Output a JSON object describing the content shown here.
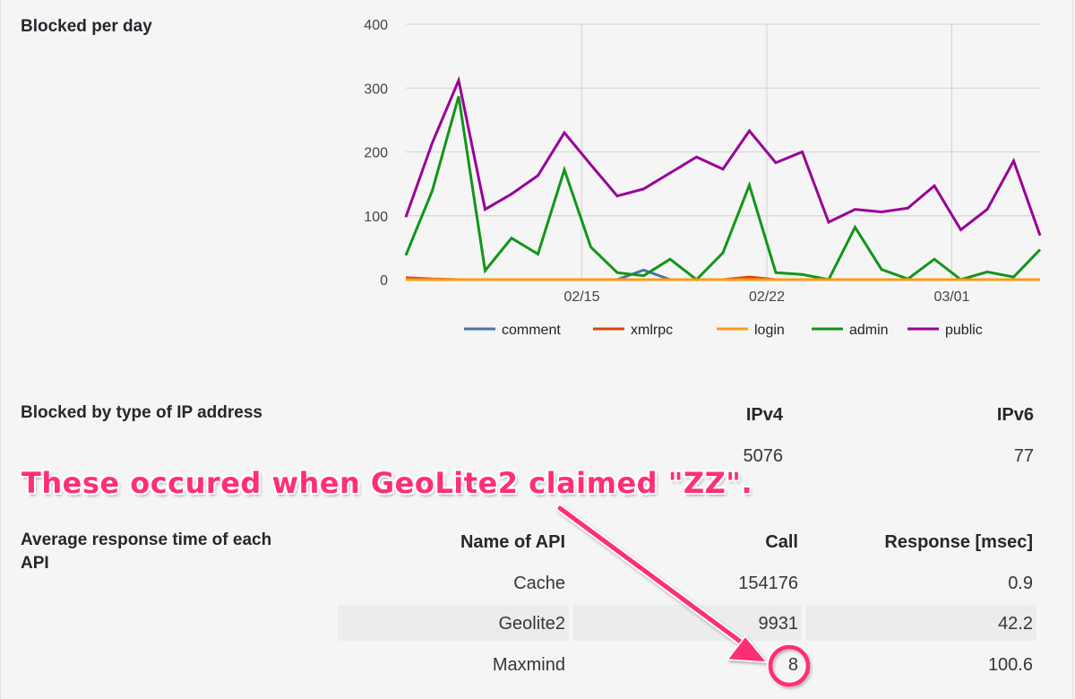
{
  "sections": {
    "blocked_per_day": "Blocked per day",
    "blocked_by_ip_type": "Blocked by type of IP address",
    "avg_response": "Average response time of each API"
  },
  "chart_data": {
    "type": "line",
    "title": "Blocked per day",
    "xlabel": "",
    "ylabel": "",
    "ylim": [
      0,
      400
    ],
    "yticks": [
      0,
      100,
      200,
      300,
      400
    ],
    "grid": true,
    "legend_position": "bottom",
    "x": [
      "02/08",
      "02/09",
      "02/10",
      "02/11",
      "02/12",
      "02/13",
      "02/14",
      "02/15",
      "02/16",
      "02/17",
      "02/18",
      "02/19",
      "02/20",
      "02/21",
      "02/22",
      "02/23",
      "02/24",
      "02/25",
      "02/26",
      "02/27",
      "02/28",
      "03/01",
      "03/02",
      "03/03",
      "03/04"
    ],
    "xtick_labels": [
      "02/15",
      "02/22",
      "03/01"
    ],
    "series": [
      {
        "name": "comment",
        "color": "#4e6fa8",
        "values": [
          0,
          0,
          0,
          0,
          0,
          0,
          0,
          0,
          0,
          15,
          0,
          0,
          0,
          0,
          0,
          0,
          0,
          0,
          0,
          0,
          0,
          0,
          0,
          0,
          0
        ]
      },
      {
        "name": "xmlrpc",
        "color": "#e0420b",
        "values": [
          3,
          1,
          0,
          0,
          0,
          0,
          0,
          0,
          0,
          0,
          0,
          0,
          0,
          4,
          0,
          0,
          0,
          0,
          0,
          0,
          0,
          0,
          0,
          0,
          0
        ]
      },
      {
        "name": "login",
        "color": "#ff9a14",
        "values": [
          0,
          0,
          0,
          0,
          0,
          0,
          0,
          0,
          0,
          0,
          0,
          0,
          0,
          0,
          0,
          0,
          0,
          0,
          0,
          0,
          0,
          0,
          0,
          0,
          0
        ]
      },
      {
        "name": "admin",
        "color": "#109618",
        "values": [
          38,
          139,
          287,
          14,
          65,
          40,
          172,
          51,
          11,
          6,
          32,
          0,
          42,
          148,
          11,
          8,
          0,
          82,
          16,
          1,
          32,
          0,
          12,
          4,
          47
        ]
      },
      {
        "name": "public",
        "color": "#990099",
        "values": [
          98,
          214,
          312,
          110,
          134,
          163,
          230,
          180,
          131,
          142,
          167,
          192,
          173,
          233,
          183,
          200,
          90,
          110,
          106,
          112,
          147,
          78,
          110,
          186,
          69
        ]
      }
    ]
  },
  "ip_type": {
    "headers": [
      "IPv4",
      "IPv6"
    ],
    "values": [
      "5076",
      "77"
    ]
  },
  "api_table": {
    "headers": [
      "Name of API",
      "Call",
      "Response [msec]"
    ],
    "rows": [
      [
        "Cache",
        "154176",
        "0.9"
      ],
      [
        "Geolite2",
        "9931",
        "42.2"
      ],
      [
        "Maxmind",
        "8",
        "100.6"
      ]
    ]
  },
  "annotation": {
    "text": "These occured when GeoLite2 claimed \"ZZ\".",
    "color": "#ff2f73",
    "target": "Maxmind call count"
  }
}
